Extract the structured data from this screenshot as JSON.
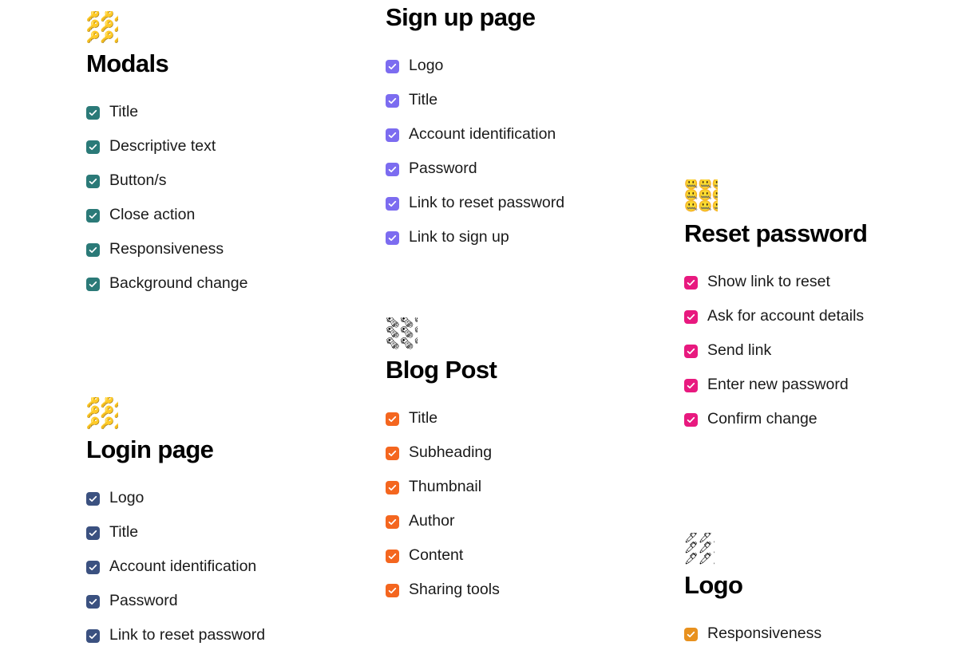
{
  "page": {
    "background_color": "#ffffff",
    "label_text_color": "#1a1a1a",
    "heading_text_color": "#000000"
  },
  "cards": [
    {
      "id": "modals",
      "title": "Modals",
      "emoji": "🔑",
      "emoji_name": "key-emoji",
      "accent_color": "#2b7a78",
      "items": [
        "Title",
        "Descriptive text",
        "Button/s",
        "Close action",
        "Responsiveness",
        "Background change"
      ]
    },
    {
      "id": "signup",
      "title": "Sign up page",
      "title_clipped": true,
      "emoji": "🔒",
      "emoji_name": "lock-emoji",
      "accent_color": "#7c6cf0",
      "items": [
        "Logo",
        "Title",
        "Account identification",
        "Password",
        "Link to reset password",
        "Link to sign up"
      ]
    },
    {
      "id": "reset",
      "title": "Reset password",
      "emoji": "🤐",
      "emoji_name": "zipper-mouth-face-emoji",
      "accent_color": "#e8197f",
      "items": [
        "Show link to reset",
        "Ask for account details",
        "Send link",
        "Enter new password",
        "Confirm change"
      ]
    },
    {
      "id": "login",
      "title": "Login page",
      "emoji": "🔑",
      "emoji_name": "key-emoji",
      "accent_color": "#3b5180",
      "items": [
        "Logo",
        "Title",
        "Account identification",
        "Password",
        "Link to reset password"
      ]
    },
    {
      "id": "blogpost",
      "title": "Blog Post",
      "emoji": "🗞",
      "emoji_name": "rolled-newspaper-emoji",
      "accent_color": "#f4661f",
      "items": [
        "Title",
        "Subheading",
        "Thumbnail",
        "Author",
        "Content",
        "Sharing tools"
      ]
    },
    {
      "id": "logo",
      "title": "Logo",
      "emoji": "🖊",
      "emoji_name": "pen-emoji",
      "accent_color": "#e8911e",
      "items": [
        "Responsiveness"
      ]
    }
  ]
}
